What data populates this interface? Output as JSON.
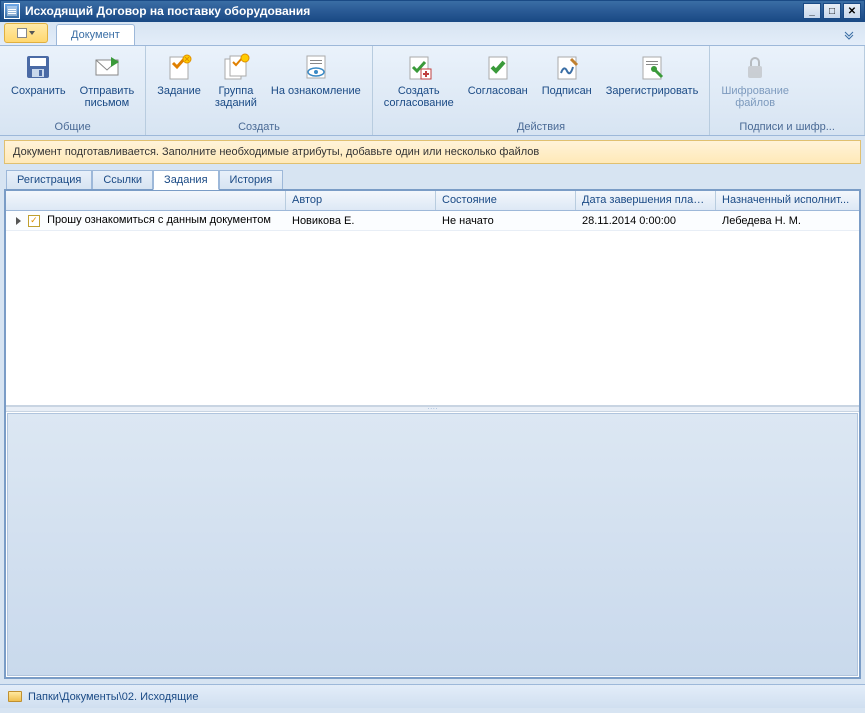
{
  "window": {
    "title": "Исходящий Договор на поставку оборудования"
  },
  "menu": {
    "tab": "Документ"
  },
  "ribbon": {
    "groups": [
      {
        "label": "Общие",
        "items": [
          {
            "id": "save",
            "label": "Сохранить"
          },
          {
            "id": "send-mail",
            "label": "Отправить\nписьмом"
          }
        ]
      },
      {
        "label": "Создать",
        "items": [
          {
            "id": "task",
            "label": "Задание"
          },
          {
            "id": "task-group",
            "label": "Группа\nзаданий"
          },
          {
            "id": "review",
            "label": "На ознакомление"
          }
        ]
      },
      {
        "label": "Действия",
        "items": [
          {
            "id": "create-approval",
            "label": "Создать\nсогласование"
          },
          {
            "id": "approved",
            "label": "Согласован"
          },
          {
            "id": "signed",
            "label": "Подписан"
          },
          {
            "id": "register",
            "label": "Зарегистрировать"
          }
        ]
      },
      {
        "label": "Подписи и шифр...",
        "items": [
          {
            "id": "encrypt",
            "label": "Шифрование\nфайлов",
            "disabled": true
          }
        ]
      }
    ]
  },
  "info": {
    "text": "Документ подготавливается. Заполните необходимые атрибуты, добавьте один или несколько файлов"
  },
  "tabs": [
    {
      "label": "Регистрация",
      "active": false
    },
    {
      "label": "Ссылки",
      "active": false
    },
    {
      "label": "Задания",
      "active": true
    },
    {
      "label": "История",
      "active": false
    }
  ],
  "grid": {
    "headers": [
      "",
      "Автор",
      "Состояние",
      "Дата завершения плано...",
      "Назначенный исполнит..."
    ],
    "rows": [
      {
        "title": "Прошу ознакомиться с данным документом",
        "author": "Новикова Е.",
        "state": "Не начато",
        "due": "28.11.2014 0:00:00",
        "assignee": "Лебедева Н. М."
      }
    ]
  },
  "status": {
    "path": "Папки\\Документы\\02. Исходящие"
  }
}
